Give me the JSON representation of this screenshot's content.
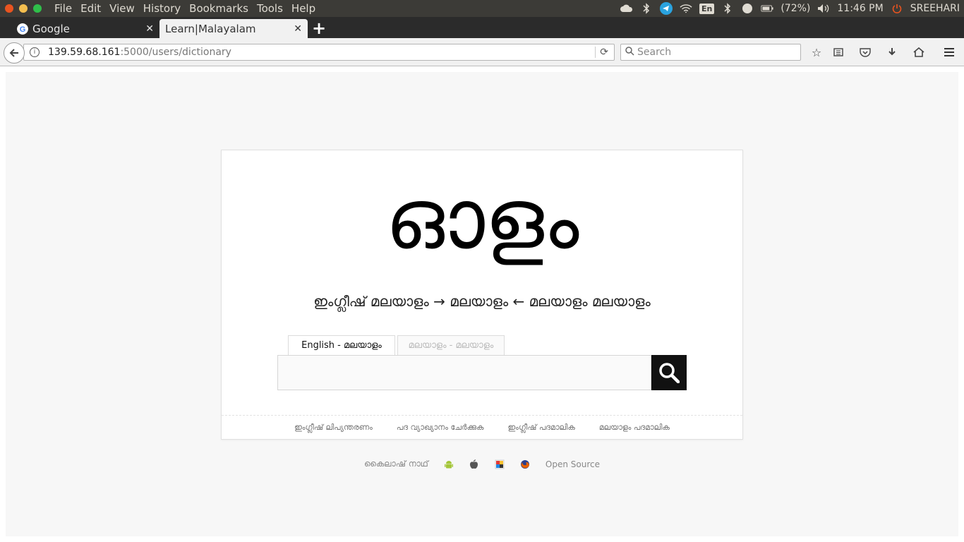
{
  "os_bar": {
    "menu": [
      "File",
      "Edit",
      "View",
      "History",
      "Bookmarks",
      "Tools",
      "Help"
    ],
    "en_indicator": "En",
    "battery": "(72%)",
    "time": "11:46 PM",
    "user": "SREEHARI"
  },
  "tabs": [
    {
      "label": "Google",
      "active": false
    },
    {
      "label": "Learn|Malayalam",
      "active": true
    }
  ],
  "new_tab_label": "+",
  "address": {
    "host": "139.59.68.161",
    "path": ":5000/users/dictionary"
  },
  "search": {
    "placeholder": "Search"
  },
  "page": {
    "logo": "ഓളം",
    "tagline": "ഇംഗ്ലീഷ് മലയാളം → മലയാളം ← മലയാളം മലയാളം",
    "lang_tabs": [
      "English - മലയാളം",
      "മലയാളം - മലയാളം"
    ],
    "input_value": "",
    "footer_links": [
      "ഇംഗ്ലീഷ് ലിപ്യന്തരണം",
      "പദ വ്യാഖ്യാനം ചേർക്കുക",
      "ഇംഗ്ലീഷ് പദമാലിക",
      "മലയാളം പദമാലിക"
    ],
    "bottom": {
      "credit": "കൈലാഷ് നാഥ്",
      "open_source": "Open Source"
    }
  },
  "colors": {
    "os_bar": "#3c3b37",
    "tab_strip": "#2b2b2b",
    "search_button": "#111111",
    "page_bg": "#f7f7f7"
  }
}
